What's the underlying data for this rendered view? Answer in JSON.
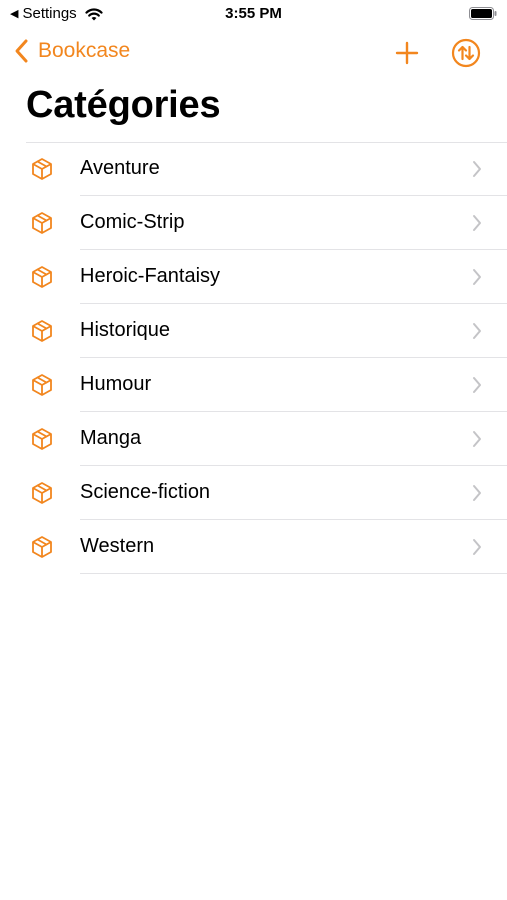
{
  "status_bar": {
    "back_app": "Settings",
    "time": "3:55 PM"
  },
  "nav": {
    "back_label": "Bookcase",
    "accent_color": "#F2861E"
  },
  "page": {
    "title": "Catégories"
  },
  "categories": [
    {
      "label": "Aventure",
      "icon": "cube-icon"
    },
    {
      "label": "Comic-Strip",
      "icon": "cube-icon"
    },
    {
      "label": "Heroic-Fantaisy",
      "icon": "cube-icon"
    },
    {
      "label": "Historique",
      "icon": "cube-icon"
    },
    {
      "label": "Humour",
      "icon": "cube-icon"
    },
    {
      "label": "Manga",
      "icon": "cube-icon"
    },
    {
      "label": "Science-fiction",
      "icon": "cube-icon"
    },
    {
      "label": "Western",
      "icon": "cube-icon"
    }
  ]
}
